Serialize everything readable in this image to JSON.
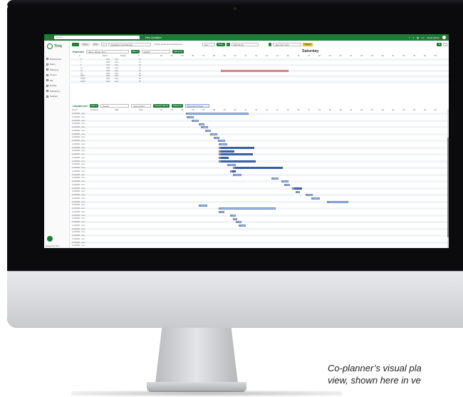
{
  "app": {
    "logo_text": "Tiriq",
    "search_placeholder": "Search",
    "new_quotation": "New Quotation",
    "user_name": "Admin Admin",
    "language": "en"
  },
  "sidebar": {
    "items": [
      {
        "label": "Dashboards",
        "icon": "dashboard-icon"
      },
      {
        "label": "Sales",
        "icon": "cart-icon"
      },
      {
        "label": "Planning",
        "icon": "calendar-icon"
      },
      {
        "label": "Invoice",
        "icon": "document-icon"
      },
      {
        "label": "HR",
        "icon": "people-icon"
      },
      {
        "label": "Quality",
        "icon": "check-icon"
      },
      {
        "label": "Publishing",
        "icon": "book-icon"
      },
      {
        "label": "Settings",
        "icon": "gear-icon"
      }
    ],
    "powered_by": "powered by Tiriq"
  },
  "toolbar": {
    "nav_label": "← →",
    "chip1": "Spine",
    "chip2": "Bind",
    "type_placeholder": "Type/Enter new Planning",
    "include_label": "Include under-level departments",
    "view_select": "Day",
    "today_btn": "Today",
    "date_value": "2020-11-20",
    "sort_select": "Start from: Item",
    "reset_btn": "Reset"
  },
  "planned": {
    "title": "Planned",
    "group_select": "Name, Design, Item",
    "filter_btn": "Filter 4",
    "search_placeholder": "Search",
    "select_all": "Select All",
    "day_label": "Saturday",
    "col_headers": [
      "#",
      "Name",
      "Design",
      "#"
    ],
    "rows": [
      [
        "9",
        "1001",
        "Grey",
        "13"
      ],
      [
        "7",
        "1005",
        "Grey",
        "23"
      ],
      [
        "6",
        "1010",
        "Grey",
        "34"
      ],
      [
        "14",
        "1086",
        "Grey",
        "37"
      ],
      [
        "15",
        "1095",
        "Grey",
        "20"
      ],
      [
        "16",
        "4001",
        "Grey",
        "20"
      ],
      [
        "2050",
        "2245",
        "Grey",
        "40"
      ],
      [
        "10003",
        "3212",
        "Grey",
        "48"
      ],
      [
        "10004",
        "4512",
        "Grey",
        "55"
      ]
    ],
    "hours": [
      "03",
      "04",
      "05",
      "06",
      "07",
      "08",
      "09",
      "10",
      "11",
      "12",
      "13",
      "14",
      "15",
      "16",
      "17",
      "18",
      "19",
      "20",
      "21",
      "22",
      "23",
      "00",
      "01",
      "02",
      "03",
      "04",
      "05"
    ]
  },
  "unplanned": {
    "title": "Unplanned",
    "filter_btn": "Filter 4",
    "search_placeholder": "Search",
    "select_action": "Select action",
    "deselect_btn": "Deselect All (1)",
    "select_all": "Select All",
    "show_btn": "Over plan (1 time)",
    "col_headers": [
      "Tim ID",
      "Customer",
      "Shift",
      "Prod"
    ],
    "row_label": "12-000001 - Item"
  }
}
